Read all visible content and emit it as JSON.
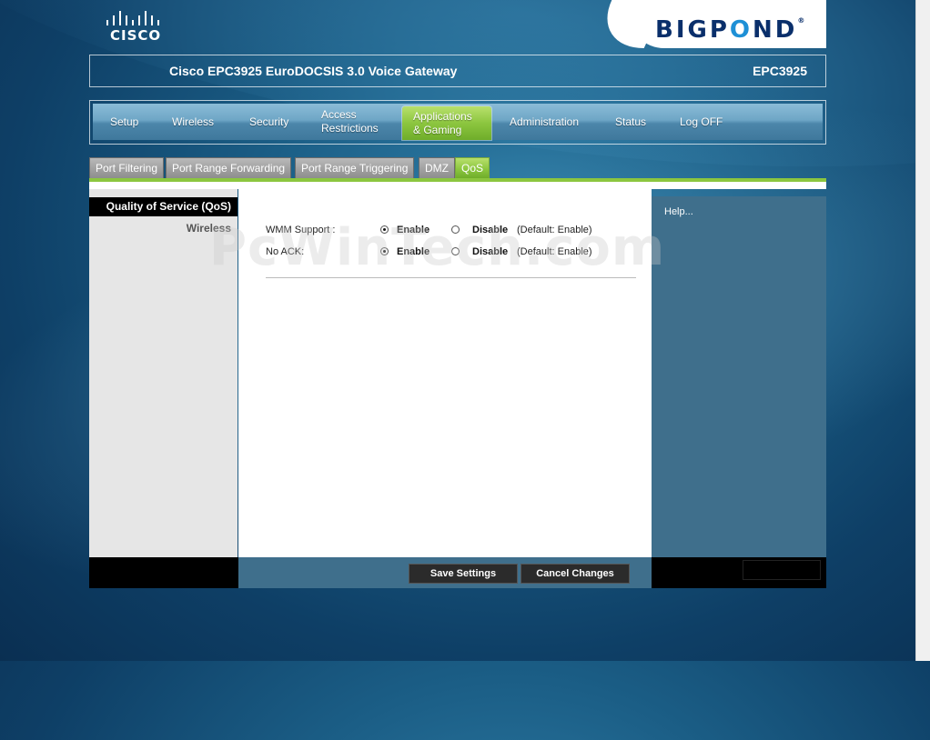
{
  "brand": {
    "cisco": "CISCO",
    "bigpond": "BIGP",
    "bigpond_o": "O",
    "bigpond_end": "ND",
    "reg": "®"
  },
  "header": {
    "title": "Cisco EPC3925 EuroDOCSIS 3.0 Voice Gateway",
    "model": "EPC3925"
  },
  "nav": {
    "items": [
      {
        "label": "Setup"
      },
      {
        "label": "Wireless"
      },
      {
        "label": "Security"
      },
      {
        "label": "Access\nRestrictions"
      },
      {
        "label": "Applications\n& Gaming",
        "active": true
      },
      {
        "label": "Administration"
      },
      {
        "label": "Status"
      },
      {
        "label": "Log OFF"
      }
    ]
  },
  "subtabs": [
    "Port Filtering",
    "Port Range Forwarding",
    "Port Range Triggering",
    "DMZ",
    "QoS"
  ],
  "sidebar": {
    "section": "Quality of Service (QoS)",
    "subsection": "Wireless"
  },
  "form": {
    "wmm": {
      "label": "WMM Support :",
      "enable": "Enable",
      "disable": "Disable",
      "default": "(Default: Enable)"
    },
    "noack": {
      "label": "No ACK:",
      "enable": "Enable",
      "disable": "Disable",
      "default": "(Default: Enable)"
    }
  },
  "help": {
    "label": "Help..."
  },
  "buttons": {
    "save": "Save Settings",
    "cancel": "Cancel Changes"
  },
  "watermark": "PcWinTech.com",
  "colors": {
    "accent_green": "#8cc63f",
    "panel_blue": "#3f6f8c"
  }
}
